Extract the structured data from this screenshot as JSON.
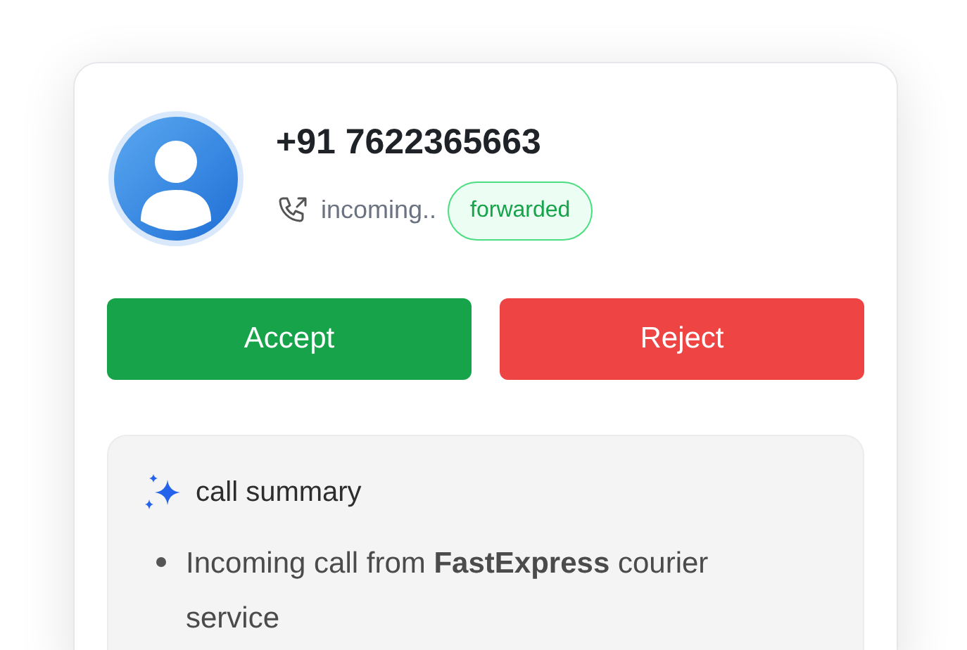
{
  "caller": {
    "number": "+91 7622365663",
    "status": "incoming..",
    "badge": "forwarded"
  },
  "actions": [
    {
      "kind": "accept",
      "label": "Accept"
    },
    {
      "kind": "reject",
      "label": "Reject"
    }
  ],
  "summary": {
    "title": "call summary",
    "items": [
      "Incoming call from **FastExpress** courier service"
    ]
  }
}
